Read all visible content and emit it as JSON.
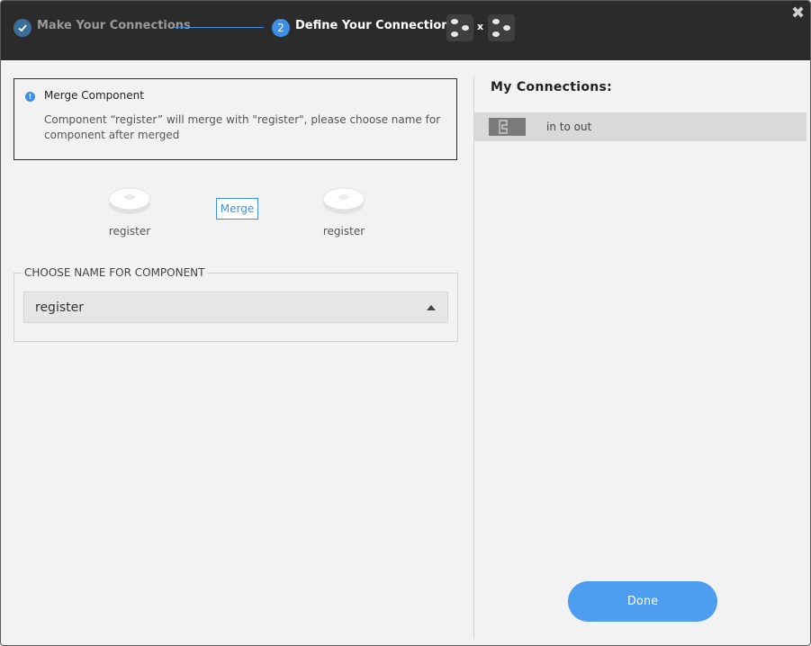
{
  "header": {
    "step1_label": "Make Your Connections",
    "step2_number": "2",
    "step2_label": "Define Your Connections",
    "times": "x",
    "close": "✖"
  },
  "notice": {
    "title": "Merge Component",
    "body": "Component “register” will merge with \"register\", please choose name for component after merged"
  },
  "merge": {
    "left_component": "register",
    "button_label": "Merge",
    "right_component": "register"
  },
  "choose_name": {
    "legend": "CHOOSE NAME FOR COMPONENT",
    "selected": "register"
  },
  "connections": {
    "title": "My Connections:",
    "items": [
      {
        "label": "in to out",
        "icon": "connection-icon"
      }
    ]
  },
  "footer": {
    "done_label": "Done"
  },
  "colors": {
    "accent": "#3d8fe6",
    "header_bg": "#2b2b2b",
    "panel_bg": "#f2f2f2",
    "done_bg": "#4d9df0"
  }
}
